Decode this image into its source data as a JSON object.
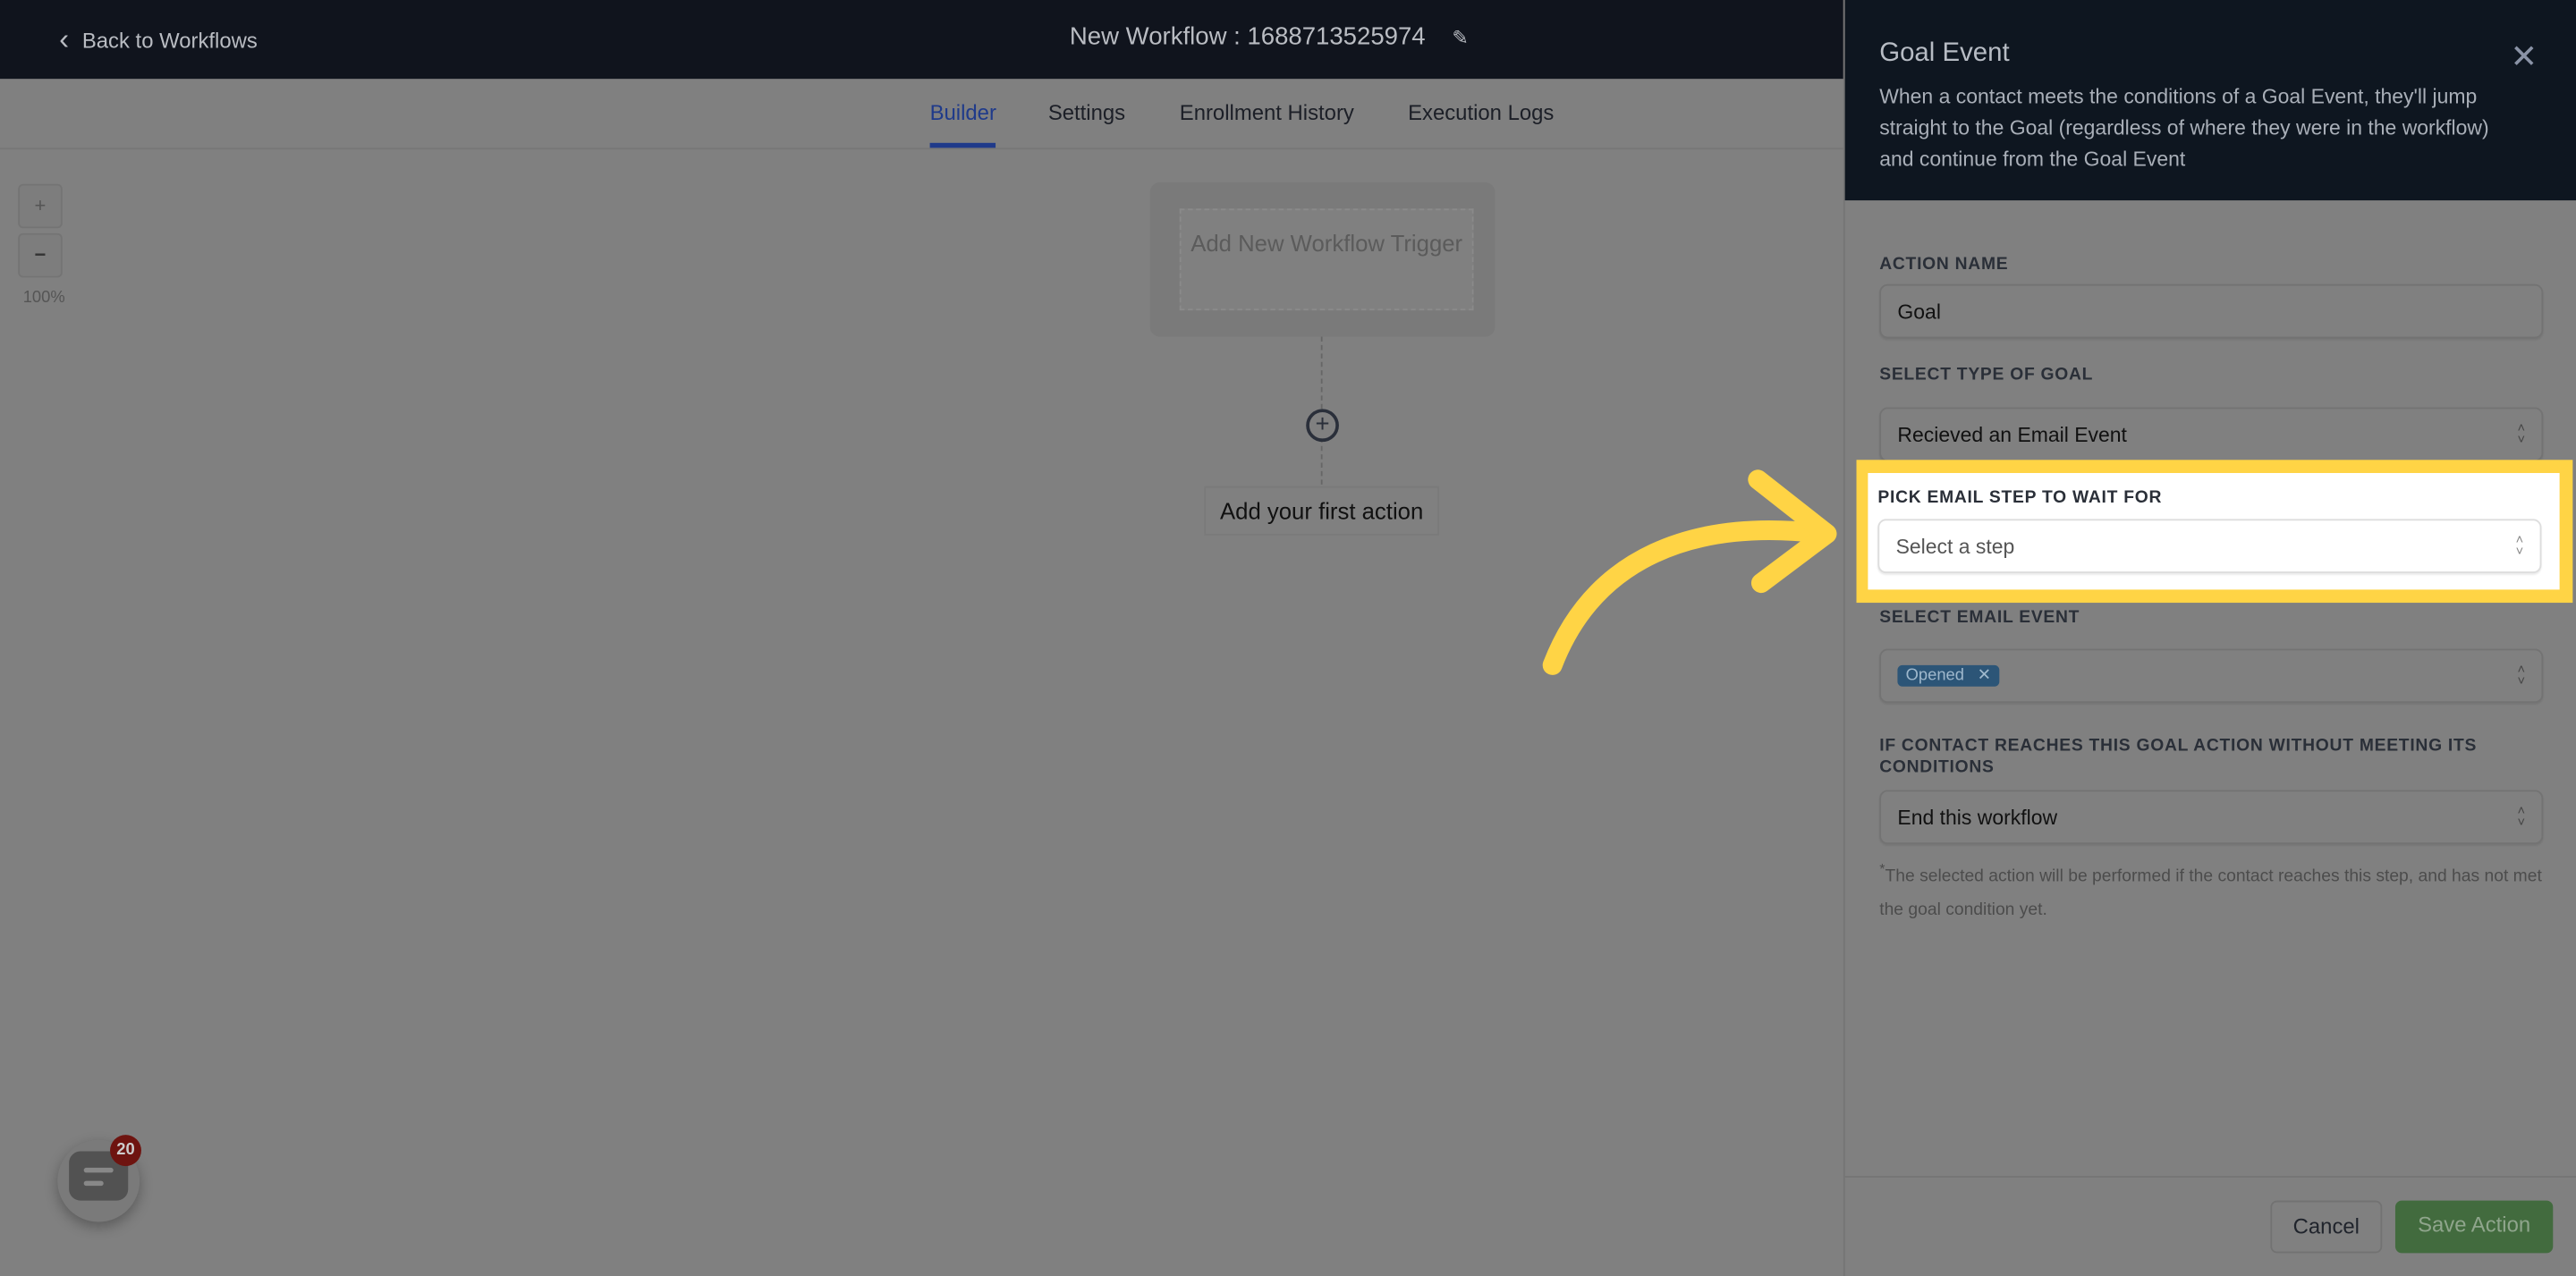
{
  "header": {
    "back_label": "Back to Workflows",
    "title": "New Workflow : 1688713525974"
  },
  "tabs": [
    {
      "label": "Builder",
      "active": true
    },
    {
      "label": "Settings"
    },
    {
      "label": "Enrollment History"
    },
    {
      "label": "Execution Logs"
    }
  ],
  "canvas": {
    "zoom_in": "+",
    "zoom_out": "−",
    "zoom_level": "100%",
    "trigger_label": "Add New Workflow Trigger",
    "first_action": "Add your first action"
  },
  "panel": {
    "title": "Goal Event",
    "description": "When a contact meets the conditions of a Goal Event, they'll jump straight to the Goal (regardless of where they were in the workflow) and continue from the Goal Event",
    "action_name_label": "ACTION NAME",
    "action_name_value": "Goal",
    "goal_type_label": "SELECT TYPE OF GOAL",
    "goal_type_value": "Recieved an Email Event",
    "email_step_label": "PICK EMAIL STEP TO WAIT FOR",
    "email_step_placeholder": "Select a step",
    "email_event_label": "SELECT EMAIL EVENT",
    "email_event_chip": "Opened",
    "fallback_label": "IF CONTACT REACHES THIS GOAL ACTION WITHOUT MEETING ITS CONDITIONS",
    "fallback_value": "End this workflow",
    "fallback_note": "The selected action will be performed if the contact reaches this step, and has not met the goal condition yet.",
    "cancel": "Cancel",
    "save": "Save Action"
  },
  "chat": {
    "badge_count": "20"
  },
  "colors": {
    "highlight": "#ffd445",
    "accent": "#1f3a8a",
    "save": "#426b3e"
  }
}
